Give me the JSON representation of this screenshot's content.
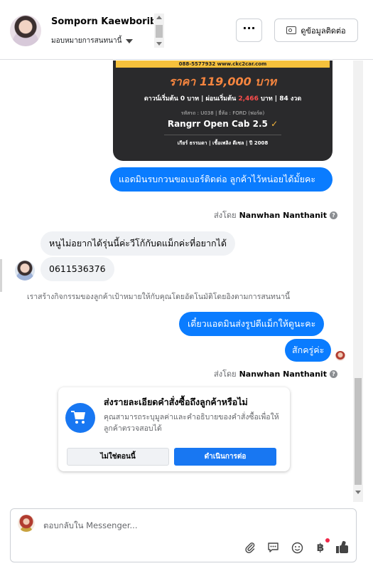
{
  "header": {
    "contact_name": "Somporn Kaewboribat",
    "assign_label": "มอบหมายการสนทนานี้",
    "more_label": "···",
    "info_button_label": "ดูข้อมูลติดต่อ"
  },
  "product_image": {
    "phone_text": "088-5577932 www.ckc2car.com",
    "price_text": "ราคา 119,000 บาท",
    "terms_a": "ดาวน์เริ่มต้น 0 บาท | ผ่อนเริ่มต้น ",
    "terms_red": "2,466",
    "terms_b": " บาท | 84 งวด",
    "meta_text": "รหัสรถ : U038 | ยี่ห้อ : FORD (ฟอร์ด)",
    "model_text": "Rangrr Open Cab 2.5",
    "specs_text": "เกียร์ ธรรมดา  |  เชื้อเพลิง ดีเซล  |  ปี 2008"
  },
  "messages": [
    {
      "id": "m1",
      "direction": "outgoing",
      "text": "แอดมินรบกวนขอเบอร์ติดต่อ ลูกค้าไว้หน่อยได้มั้ยคะ"
    },
    {
      "id": "m2",
      "direction": "incoming",
      "text": "หนูไม่อยากได้รุ่นนี้ค่ะวีโก้กับดแม็กค่ะที่อยากได้"
    },
    {
      "id": "m3",
      "direction": "incoming",
      "text": "0611536376"
    },
    {
      "id": "m4",
      "direction": "outgoing",
      "text": "เดี๋ยวแอดมินส่งรูปดีแม็กให้ดูนะคะ"
    },
    {
      "id": "m5",
      "direction": "outgoing",
      "text": "สักครู่ค่ะ"
    }
  ],
  "sent_by": {
    "prefix": "ส่งโดย",
    "name_1": "Nanwhan Nanthanit",
    "name_2": "Nanwhan Nanthanit",
    "help_icon": "?"
  },
  "system_notice": "เราสร้างกิจกรรมของลูกค้าเป้าหมายให้กับคุณโดยอัตโนมัติโดยอิงตามการสนทนานี้",
  "order_prompt": {
    "title": "ส่งรายละเอียดคำสั่งซื้อถึงลูกค้าหรือไม่",
    "description": "คุณสามารถระบุมูลค่าและคำอธิบายของคำสั่งซื้อเพื่อให้ลูกค้าตรวจสอบได้",
    "decline_label": "ไม่ใช่ตอนนี้",
    "continue_label": "ดำเนินการต่อ",
    "icon": "cart-icon"
  },
  "composer": {
    "placeholder": "ตอบกลับใน Messenger...",
    "tool_icons": [
      "attachment-icon",
      "saved-reply-icon",
      "emoji-icon",
      "payment-icon",
      "like-icon"
    ],
    "payment_symbol": "฿"
  },
  "colors": {
    "outgoing_bubble": "#0a7cff",
    "incoming_bubble": "#f0f2f5",
    "primary_button": "#1877f2",
    "price_orange": "#f5853f"
  }
}
